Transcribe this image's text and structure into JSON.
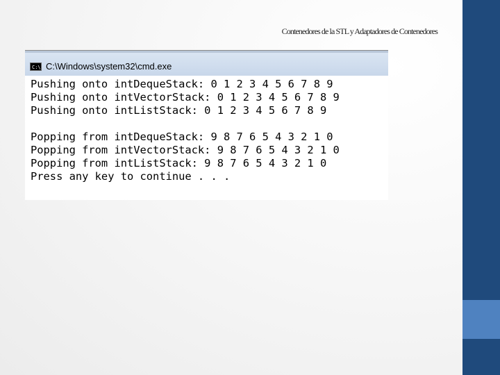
{
  "slide": {
    "title": "Contenedores de la STL y Adaptadores de Contenedores"
  },
  "window": {
    "title": "C:\\Windows\\system32\\cmd.exe",
    "icon": "cmd-icon"
  },
  "console": {
    "lines": [
      "Pushing onto intDequeStack: 0 1 2 3 4 5 6 7 8 9",
      "Pushing onto intVectorStack: 0 1 2 3 4 5 6 7 8 9",
      "Pushing onto intListStack: 0 1 2 3 4 5 6 7 8 9",
      "",
      "Popping from intDequeStack: 9 8 7 6 5 4 3 2 1 0",
      "Popping from intVectorStack: 9 8 7 6 5 4 3 2 1 0",
      "Popping from intListStack: 9 8 7 6 5 4 3 2 1 0",
      "Press any key to continue . . ."
    ]
  },
  "colors": {
    "sidebar": "#1f4a7c",
    "sidebar_accent": "#4f82c0",
    "titlebar": "#c8d7ea"
  }
}
